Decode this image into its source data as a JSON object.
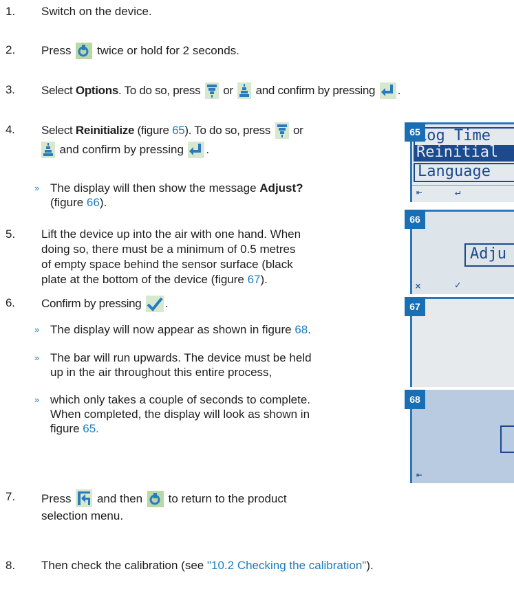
{
  "steps": [
    {
      "num": "1.",
      "text": "Switch on the device."
    },
    {
      "num": "2.",
      "pre": "Press",
      "post": "twice or hold for 2 seconds."
    },
    {
      "num": "3.",
      "pre": "Select",
      "bold": "Options",
      "mid": ". To do so, press",
      "or": "or",
      "post": "and confirm by pressing",
      "end": "."
    },
    {
      "num": "4.",
      "pre": "Select",
      "bold": "Reinitialize",
      "fig_open": "(figure",
      "fig": "65",
      "fig_close": "). To do so, press",
      "or": "or",
      "post": "and confirm by pressing",
      "end": "."
    },
    {
      "num": "5.",
      "lines": [
        "Lift the device up into the air with one hand. When",
        "doing so, there must be a minimum of 0.5 metres",
        "of empty space behind the sensor surface (black"
      ],
      "last": "plate at the bottom of the device (figure",
      "fig": "67",
      "close": ")."
    },
    {
      "num": "6.",
      "text": "Confirm by pressing",
      "end": "."
    },
    {
      "num": "7.",
      "pre": "Press",
      "mid": "and then",
      "post": "to return to the product",
      "line2": "selection menu."
    },
    {
      "num": "8.",
      "pre": "Then check the calibration (see",
      "link": "\"10.2 Checking the calibration\"",
      "close": ")."
    }
  ],
  "bullets": {
    "b1": {
      "pre": "The display will then show the message",
      "bold": "Adjust?",
      "line2_pre": "(figure",
      "fig": "66",
      "line2_post": ")."
    },
    "b2": {
      "pre": "The display will now appear as shown in figure",
      "fig": "68",
      "end": "."
    },
    "b3": {
      "l1": "The bar will run upwards. The device must be held",
      "l2": "up in the air throughout this entire process,"
    },
    "b4": {
      "l1": "which only takes a couple of seconds to complete.",
      "l2": "When completed, the display will look as shown in",
      "l3_pre": "figure",
      "fig": "65."
    }
  },
  "bullet_mark": "»",
  "figures": [
    {
      "label": "65",
      "lines": [
        "Log Time",
        "Reinitial",
        "Language"
      ],
      "softkeys": [
        "⇤",
        "↵"
      ]
    },
    {
      "label": "66",
      "message": "Adju",
      "softkeys": [
        "×",
        "✓"
      ]
    },
    {
      "label": "67"
    },
    {
      "label": "68",
      "softkeys": [
        "⇤"
      ]
    }
  ],
  "icons": [
    "power-circle-icon",
    "arrow-down-icon",
    "arrow-up-icon",
    "enter-icon",
    "checkmark-icon",
    "back-icon"
  ]
}
